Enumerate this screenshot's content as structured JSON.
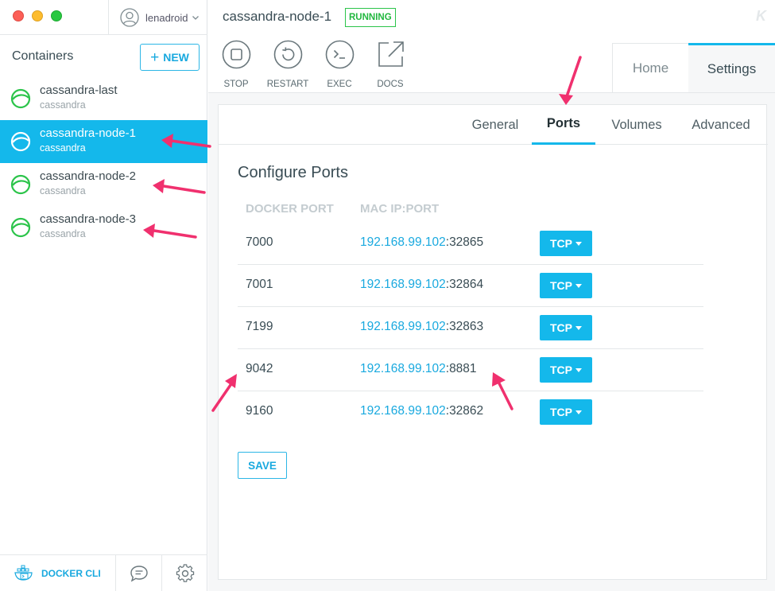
{
  "user": {
    "name": "lenadroid"
  },
  "sidebar": {
    "title": "Containers",
    "new_button": {
      "plus": "+",
      "label": "NEW"
    },
    "containers": [
      {
        "name": "cassandra-last",
        "image": "cassandra",
        "active": false
      },
      {
        "name": "cassandra-node-1",
        "image": "cassandra",
        "active": true
      },
      {
        "name": "cassandra-node-2",
        "image": "cassandra",
        "active": false
      },
      {
        "name": "cassandra-node-3",
        "image": "cassandra",
        "active": false
      }
    ],
    "footer": {
      "docker_cli": "DOCKER CLI",
      "chat_icon": "chat-icon",
      "settings_icon": "gear-icon"
    }
  },
  "header": {
    "container_name": "cassandra-node-1",
    "status": "RUNNING",
    "status_color": "#21b83f",
    "logo": "K",
    "actions": [
      {
        "label": "STOP",
        "icon": "stop-icon"
      },
      {
        "label": "RESTART",
        "icon": "restart-icon"
      },
      {
        "label": "EXEC",
        "icon": "terminal-icon"
      },
      {
        "label": "DOCS",
        "icon": "external-link-icon"
      }
    ],
    "tabs": {
      "home": "Home",
      "settings": "Settings",
      "active": "Settings"
    }
  },
  "settings": {
    "subtabs": [
      "General",
      "Ports",
      "Volumes",
      "Advanced"
    ],
    "active_subtab": "Ports",
    "section_title": "Configure Ports",
    "columns": {
      "docker_port": "DOCKER PORT",
      "mac_ip_port": "MAC IP:PORT"
    },
    "ports": [
      {
        "docker_port": "7000",
        "ip": "192.168.99.102",
        "sep": ":",
        "port": "32865",
        "protocol": "TCP"
      },
      {
        "docker_port": "7001",
        "ip": "192.168.99.102",
        "sep": ":",
        "port": "32864",
        "protocol": "TCP"
      },
      {
        "docker_port": "7199",
        "ip": "192.168.99.102",
        "sep": ":",
        "port": "32863",
        "protocol": "TCP"
      },
      {
        "docker_port": "9042",
        "ip": "192.168.99.102",
        "sep": ":",
        "port": "8881",
        "protocol": "TCP"
      },
      {
        "docker_port": "9160",
        "ip": "192.168.99.102",
        "sep": ":",
        "port": "32862",
        "protocol": "TCP"
      }
    ],
    "save_label": "SAVE"
  },
  "colors": {
    "accent": "#14b8eb",
    "annotation_arrow": "#f0306e",
    "running": "#2bc44a"
  }
}
